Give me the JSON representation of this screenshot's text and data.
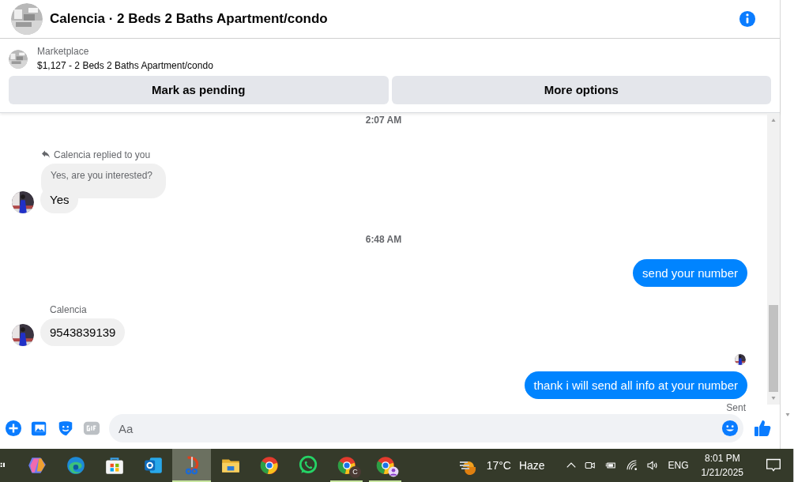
{
  "header": {
    "title": "Calencia · 2 Beds 2 Baths Apartment/condo"
  },
  "listing": {
    "source": "Marketplace",
    "summary": "$1,127 - 2 Beds 2 Baths Apartment/condo",
    "buttons": [
      "Mark as pending",
      "More options"
    ]
  },
  "messages": [
    {
      "kind": "time",
      "text": "2:07 AM"
    },
    {
      "kind": "reply",
      "note": "Calencia replied to you",
      "quote": "Yes, are you interested?",
      "text": "Yes"
    },
    {
      "kind": "time",
      "text": "6:48 AM"
    },
    {
      "kind": "outgoing",
      "text": "send your number"
    },
    {
      "kind": "incoming",
      "sender": "Calencia",
      "text": "9543839139"
    },
    {
      "kind": "seen"
    },
    {
      "kind": "outgoing",
      "text": "thank i will send all info at your number",
      "status": "Sent"
    }
  ],
  "composer": {
    "placeholder": "Aa"
  },
  "taskbar": {
    "apps": [
      {
        "kind": "copilot",
        "selected": false,
        "running": false
      },
      {
        "kind": "edge",
        "selected": false,
        "running": false
      },
      {
        "kind": "store",
        "selected": false,
        "running": false
      },
      {
        "kind": "outlook",
        "selected": false,
        "running": false
      },
      {
        "kind": "snip",
        "selected": true,
        "running": true
      },
      {
        "kind": "folder",
        "selected": false,
        "running": false
      },
      {
        "kind": "chrome",
        "selected": false,
        "running": false
      },
      {
        "kind": "whatsapp",
        "selected": false,
        "running": false
      },
      {
        "kind": "chrome",
        "badge": "C",
        "selected": false,
        "running": true
      },
      {
        "kind": "chrome-profile",
        "selected": false,
        "running": true
      }
    ],
    "weather": {
      "temperature": "17°C",
      "condition": "Haze"
    },
    "language": "ENG",
    "time": "8:01 PM",
    "date": "1/21/2025"
  }
}
